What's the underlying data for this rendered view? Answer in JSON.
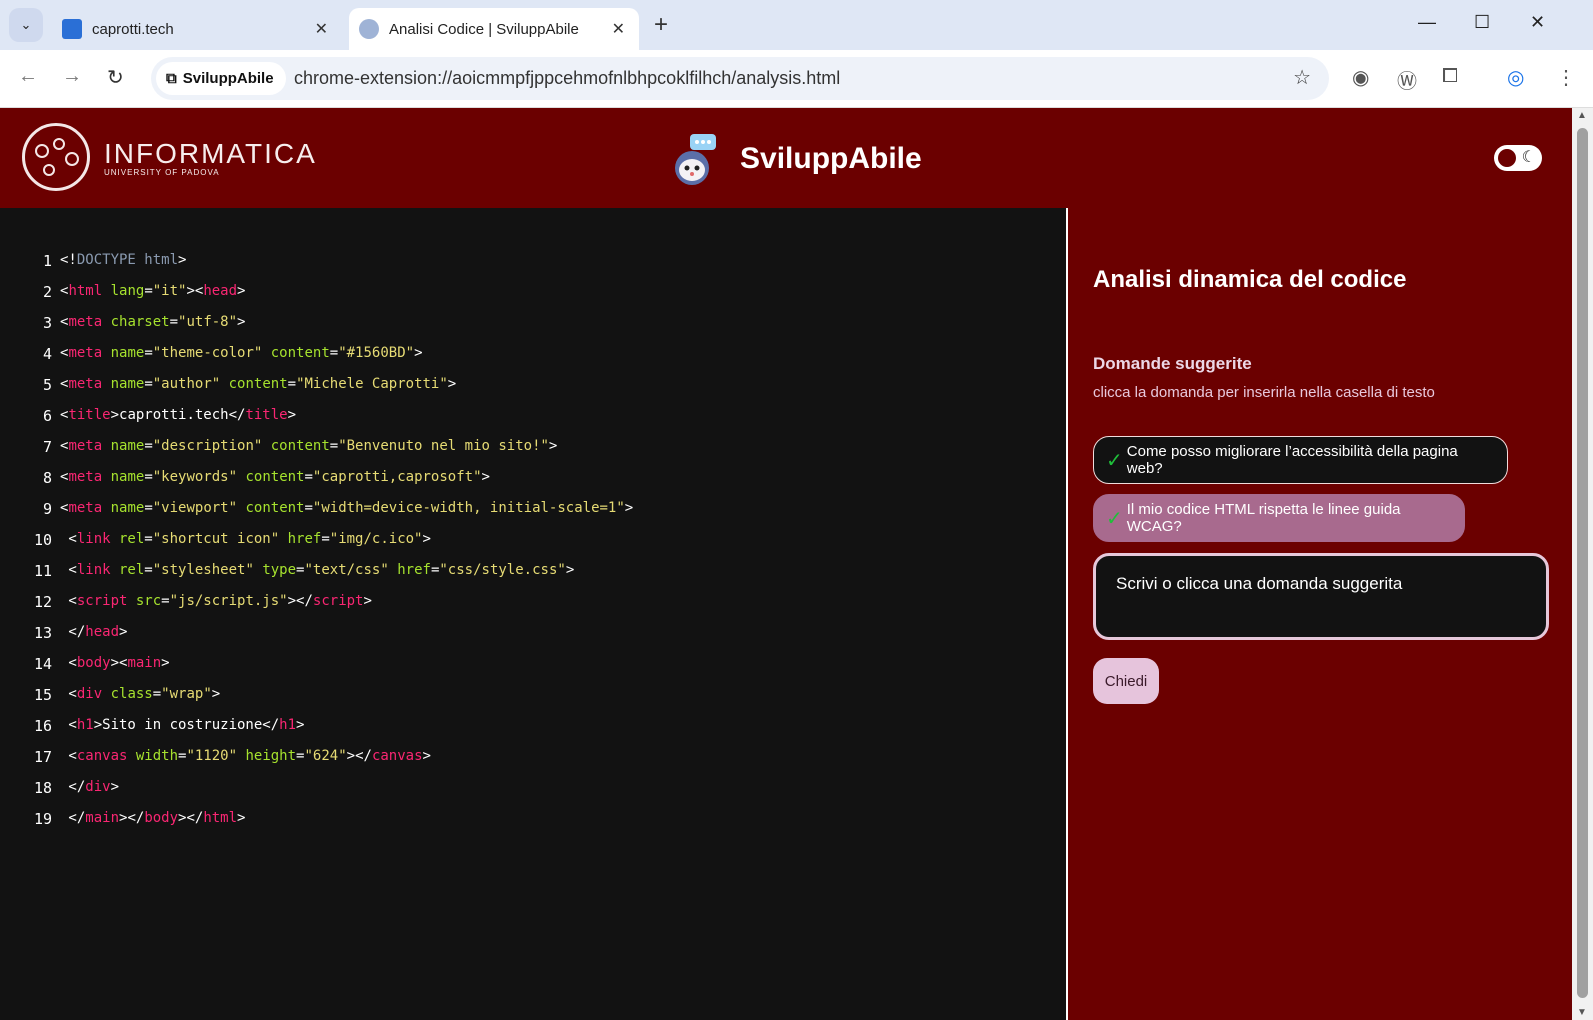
{
  "browser": {
    "tabs": [
      {
        "title": "caprotti.tech",
        "active": false
      },
      {
        "title": "Analisi Codice | SviluppAbile",
        "active": true
      }
    ],
    "site_chip": "SviluppAbile",
    "url": "chrome-extension://aoicmmpfjppcehmofnlbhpcoklfilhch/analysis.html"
  },
  "header": {
    "university_title": "INFORMATICA",
    "university_sub": "UNIVERSITY OF PADOVA",
    "app_title": "SviluppAbile"
  },
  "code_lines": [
    [
      {
        "t": "<!",
        "c": "p"
      },
      {
        "t": "DOCTYPE html",
        "c": "gray"
      },
      {
        "t": ">",
        "c": "p"
      }
    ],
    [
      {
        "t": "<",
        "c": "p"
      },
      {
        "t": "html",
        "c": "tag"
      },
      {
        "t": " lang",
        "c": "attr"
      },
      {
        "t": "=",
        "c": "p"
      },
      {
        "t": "\"it\"",
        "c": "str"
      },
      {
        "t": "><",
        "c": "p"
      },
      {
        "t": "head",
        "c": "tag"
      },
      {
        "t": ">",
        "c": "p"
      }
    ],
    [
      {
        "t": "<",
        "c": "p"
      },
      {
        "t": "meta",
        "c": "tag"
      },
      {
        "t": " charset",
        "c": "attr"
      },
      {
        "t": "=",
        "c": "p"
      },
      {
        "t": "\"utf-8\"",
        "c": "str"
      },
      {
        "t": ">",
        "c": "p"
      }
    ],
    [
      {
        "t": "<",
        "c": "p"
      },
      {
        "t": "meta",
        "c": "tag"
      },
      {
        "t": " name",
        "c": "attr"
      },
      {
        "t": "=",
        "c": "p"
      },
      {
        "t": "\"theme-color\"",
        "c": "str"
      },
      {
        "t": " content",
        "c": "attr"
      },
      {
        "t": "=",
        "c": "p"
      },
      {
        "t": "\"#1560BD\"",
        "c": "str"
      },
      {
        "t": ">",
        "c": "p"
      }
    ],
    [
      {
        "t": "<",
        "c": "p"
      },
      {
        "t": "meta",
        "c": "tag"
      },
      {
        "t": " name",
        "c": "attr"
      },
      {
        "t": "=",
        "c": "p"
      },
      {
        "t": "\"author\"",
        "c": "str"
      },
      {
        "t": " content",
        "c": "attr"
      },
      {
        "t": "=",
        "c": "p"
      },
      {
        "t": "\"Michele Caprotti\"",
        "c": "str"
      },
      {
        "t": ">",
        "c": "p"
      }
    ],
    [
      {
        "t": "<",
        "c": "p"
      },
      {
        "t": "title",
        "c": "tag"
      },
      {
        "t": ">caprotti.tech</",
        "c": "p"
      },
      {
        "t": "title",
        "c": "tag"
      },
      {
        "t": ">",
        "c": "p"
      }
    ],
    [
      {
        "t": "<",
        "c": "p"
      },
      {
        "t": "meta",
        "c": "tag"
      },
      {
        "t": " name",
        "c": "attr"
      },
      {
        "t": "=",
        "c": "p"
      },
      {
        "t": "\"description\"",
        "c": "str"
      },
      {
        "t": " content",
        "c": "attr"
      },
      {
        "t": "=",
        "c": "p"
      },
      {
        "t": "\"Benvenuto nel mio sito!\"",
        "c": "str"
      },
      {
        "t": ">",
        "c": "p"
      }
    ],
    [
      {
        "t": "<",
        "c": "p"
      },
      {
        "t": "meta",
        "c": "tag"
      },
      {
        "t": " name",
        "c": "attr"
      },
      {
        "t": "=",
        "c": "p"
      },
      {
        "t": "\"keywords\"",
        "c": "str"
      },
      {
        "t": " content",
        "c": "attr"
      },
      {
        "t": "=",
        "c": "p"
      },
      {
        "t": "\"caprotti,caprosoft\"",
        "c": "str"
      },
      {
        "t": ">",
        "c": "p"
      }
    ],
    [
      {
        "t": "<",
        "c": "p"
      },
      {
        "t": "meta",
        "c": "tag"
      },
      {
        "t": " name",
        "c": "attr"
      },
      {
        "t": "=",
        "c": "p"
      },
      {
        "t": "\"viewport\"",
        "c": "str"
      },
      {
        "t": " content",
        "c": "attr"
      },
      {
        "t": "=",
        "c": "p"
      },
      {
        "t": "\"width=device-width, initial-scale=1\"",
        "c": "str"
      },
      {
        "t": ">",
        "c": "p"
      }
    ],
    [
      {
        "t": " <",
        "c": "p"
      },
      {
        "t": "link",
        "c": "tag"
      },
      {
        "t": " rel",
        "c": "attr"
      },
      {
        "t": "=",
        "c": "p"
      },
      {
        "t": "\"shortcut icon\"",
        "c": "str"
      },
      {
        "t": " href",
        "c": "attr"
      },
      {
        "t": "=",
        "c": "p"
      },
      {
        "t": "\"img/c.ico\"",
        "c": "str"
      },
      {
        "t": ">",
        "c": "p"
      }
    ],
    [
      {
        "t": " <",
        "c": "p"
      },
      {
        "t": "link",
        "c": "tag"
      },
      {
        "t": " rel",
        "c": "attr"
      },
      {
        "t": "=",
        "c": "p"
      },
      {
        "t": "\"stylesheet\"",
        "c": "str"
      },
      {
        "t": " type",
        "c": "attr"
      },
      {
        "t": "=",
        "c": "p"
      },
      {
        "t": "\"text/css\"",
        "c": "str"
      },
      {
        "t": " href",
        "c": "attr"
      },
      {
        "t": "=",
        "c": "p"
      },
      {
        "t": "\"css/style.css\"",
        "c": "str"
      },
      {
        "t": ">",
        "c": "p"
      }
    ],
    [
      {
        "t": " <",
        "c": "p"
      },
      {
        "t": "script",
        "c": "tag"
      },
      {
        "t": " src",
        "c": "attr"
      },
      {
        "t": "=",
        "c": "p"
      },
      {
        "t": "\"js/script.js\"",
        "c": "str"
      },
      {
        "t": "></",
        "c": "p"
      },
      {
        "t": "script",
        "c": "tag"
      },
      {
        "t": ">",
        "c": "p"
      }
    ],
    [
      {
        "t": " </",
        "c": "p"
      },
      {
        "t": "head",
        "c": "tag"
      },
      {
        "t": ">",
        "c": "p"
      }
    ],
    [
      {
        "t": " <",
        "c": "p"
      },
      {
        "t": "body",
        "c": "tag"
      },
      {
        "t": "><",
        "c": "p"
      },
      {
        "t": "main",
        "c": "tag"
      },
      {
        "t": ">",
        "c": "p"
      }
    ],
    [
      {
        "t": " <",
        "c": "p"
      },
      {
        "t": "div",
        "c": "tag"
      },
      {
        "t": " class",
        "c": "attr"
      },
      {
        "t": "=",
        "c": "p"
      },
      {
        "t": "\"wrap\"",
        "c": "str"
      },
      {
        "t": ">",
        "c": "p"
      }
    ],
    [
      {
        "t": " <",
        "c": "p"
      },
      {
        "t": "h1",
        "c": "tag"
      },
      {
        "t": ">Sito in costruzione</",
        "c": "p"
      },
      {
        "t": "h1",
        "c": "tag"
      },
      {
        "t": ">",
        "c": "p"
      }
    ],
    [
      {
        "t": " <",
        "c": "p"
      },
      {
        "t": "canvas",
        "c": "tag"
      },
      {
        "t": " width",
        "c": "attr"
      },
      {
        "t": "=",
        "c": "p"
      },
      {
        "t": "\"1120\"",
        "c": "str"
      },
      {
        "t": " height",
        "c": "attr"
      },
      {
        "t": "=",
        "c": "p"
      },
      {
        "t": "\"624\"",
        "c": "str"
      },
      {
        "t": "></",
        "c": "p"
      },
      {
        "t": "canvas",
        "c": "tag"
      },
      {
        "t": ">",
        "c": "p"
      }
    ],
    [
      {
        "t": " </",
        "c": "p"
      },
      {
        "t": "div",
        "c": "tag"
      },
      {
        "t": ">",
        "c": "p"
      }
    ],
    [
      {
        "t": " </",
        "c": "p"
      },
      {
        "t": "main",
        "c": "tag"
      },
      {
        "t": "></",
        "c": "p"
      },
      {
        "t": "body",
        "c": "tag"
      },
      {
        "t": "></",
        "c": "p"
      },
      {
        "t": "html",
        "c": "tag"
      },
      {
        "t": ">",
        "c": "p"
      }
    ]
  ],
  "side": {
    "title": "Analisi dinamica del codice",
    "suggested_title": "Domande suggerite",
    "suggested_sub": "clicca la domanda per inserirla nella casella di testo",
    "suggestions": [
      "Come posso migliorare l’accessibilità della pagina web?",
      "Il mio codice HTML rispetta le linee guida WCAG?"
    ],
    "textarea_placeholder": "Scrivi o clicca una domanda suggerita",
    "ask_button": "Chiedi"
  },
  "colors": {
    "header_bg": "#6b0000",
    "code_bg": "#121212",
    "tag": "#f92672",
    "attr": "#a6e22e",
    "string": "#e6db74"
  }
}
